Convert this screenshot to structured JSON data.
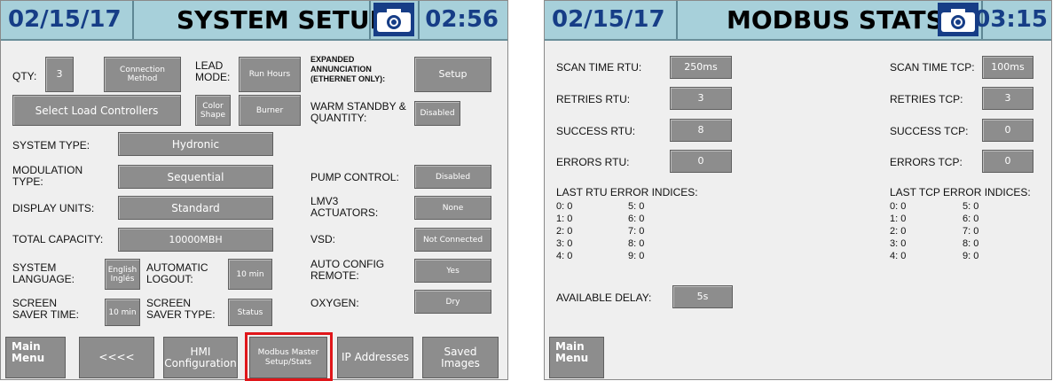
{
  "left": {
    "date": "02/15/17",
    "title": "SYSTEM SETUP",
    "time": "02:56",
    "qty_label": "QTY:",
    "qty_value": "3",
    "connection_method": "Connection Method",
    "lead_mode_label": "LEAD MODE:",
    "lead_mode_value": "Run Hours",
    "expanded_label": "EXPANDED ANNUNCIATION (ETHERNET ONLY):",
    "setup_button": "Setup",
    "select_load_controllers": "Select Load Controllers",
    "color_shape": "Color Shape",
    "burner": "Burner",
    "warm_standby_label": "WARM STANDBY & QUANTITY:",
    "warm_standby_value": "Disabled",
    "system_type_label": "SYSTEM TYPE:",
    "system_type_value": "Hydronic",
    "modulation_type_label": "MODULATION TYPE:",
    "modulation_type_value": "Sequential",
    "pump_control_label": "PUMP CONTROL:",
    "pump_control_value": "Disabled",
    "display_units_label": "DISPLAY UNITS:",
    "display_units_value": "Standard",
    "lmv3_label": "LMV3 ACTUATORS:",
    "lmv3_value": "None",
    "total_capacity_label": "TOTAL CAPACITY:",
    "total_capacity_value": "10000MBH",
    "vsd_label": "VSD:",
    "vsd_value": "Not Connected",
    "system_language_label": "SYSTEM LANGUAGE:",
    "system_language_value": "English Inglés",
    "automatic_logout_label": "AUTOMATIC LOGOUT:",
    "automatic_logout_value": "10 min",
    "auto_config_label": "AUTO CONFIG REMOTE:",
    "auto_config_value": "Yes",
    "screen_saver_time_label": "SCREEN SAVER TIME:",
    "screen_saver_time_value": "10 min",
    "screen_saver_type_label": "SCREEN SAVER TYPE:",
    "screen_saver_type_value": "Status",
    "oxygen_label": "OXYGEN:",
    "oxygen_value": "Dry",
    "nav_main_menu": "Main Menu",
    "nav_back": "<<<<",
    "nav_hmi": "HMI Configuration",
    "nav_modbus": "Modbus Master Setup/Stats",
    "nav_ip": "IP Addresses",
    "nav_saved": "Saved Images"
  },
  "right": {
    "date": "02/15/17",
    "title": "MODBUS STATS",
    "time": "03:15",
    "scan_rtu_label": "SCAN TIME RTU:",
    "scan_rtu_value": "250ms",
    "retries_rtu_label": "RETRIES RTU:",
    "retries_rtu_value": "3",
    "success_rtu_label": "SUCCESS RTU:",
    "success_rtu_value": "8",
    "errors_rtu_label": "ERRORS RTU:",
    "errors_rtu_value": "0",
    "scan_tcp_label": "SCAN TIME TCP:",
    "scan_tcp_value": "100ms",
    "retries_tcp_label": "RETRIES TCP:",
    "retries_tcp_value": "3",
    "success_tcp_label": "SUCCESS TCP:",
    "success_tcp_value": "0",
    "errors_tcp_label": "ERRORS TCP:",
    "errors_tcp_value": "0",
    "last_rtu_header": "LAST RTU ERROR INDICES:",
    "last_tcp_header": "LAST TCP ERROR INDICES:",
    "rtu_indices": [
      "0: 0",
      "1: 0",
      "2: 0",
      "3: 0",
      "4: 0",
      "5: 0",
      "6: 0",
      "7: 0",
      "8: 0",
      "9: 0"
    ],
    "tcp_indices": [
      "0: 0",
      "1: 0",
      "2: 0",
      "3: 0",
      "4: 0",
      "5: 0",
      "6: 0",
      "7: 0",
      "8: 0",
      "9: 0"
    ],
    "available_delay_label": "AVAILABLE DELAY:",
    "available_delay_value": "5s",
    "nav_main_menu": "Main Menu"
  },
  "colors": {
    "header_bg": "#a7d0da",
    "header_text": "#163d86",
    "button_gray": "#8d8d8d",
    "highlight_red": "#e0161a",
    "panel_bg": "#efefef"
  },
  "icons": [
    "camera-icon"
  ]
}
